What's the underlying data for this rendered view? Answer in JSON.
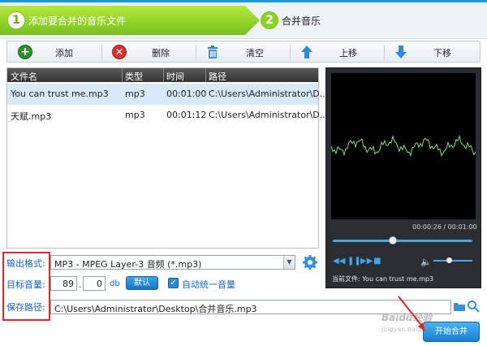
{
  "steps": [
    {
      "num": "1",
      "label": "添加要合并的音乐文件",
      "active": true
    },
    {
      "num": "2",
      "label": "合并音乐",
      "active": false
    }
  ],
  "toolbar": {
    "add_label": "添加",
    "delete_label": "删除",
    "clear_label": "清空",
    "move_up_label": "上移",
    "move_down_label": "下移"
  },
  "file_list": {
    "columns": [
      "文件名",
      "类型",
      "时间",
      "路径"
    ],
    "rows": [
      {
        "name": "You can trust me.mp3",
        "type": "mp3",
        "time": "00:01:00",
        "path": "C:\\Users\\Administrator\\D...",
        "selected": true
      },
      {
        "name": "天赋.mp3",
        "type": "mp3",
        "time": "00:01:12",
        "path": "C:\\Users\\Administrator\\D...",
        "selected": false
      }
    ]
  },
  "player": {
    "time": "00:00:26 / 00:01:00",
    "progress": 0.43,
    "volume": 0.4,
    "current_file": "当前文件: You can trust me.mp3",
    "wave_color": "#7fe07f"
  },
  "settings": {
    "format_label": "输出格式:",
    "format_value": "MP3 - MPEG Layer-3 音频 (*.mp3)",
    "volume_label": "目标音量:",
    "volume_int": "89",
    "volume_frac": "0",
    "volume_unit": "db",
    "default_btn": "默认",
    "auto_volume_label": "自动统一音量",
    "auto_volume_checked": true,
    "save_label": "保存路径:",
    "save_path": "C:\\Users\\Administrator\\Desktop\\合并音乐.mp3"
  },
  "start_button": "开始合并",
  "watermark": {
    "text": "Baidu经验",
    "url": "jingyan.baidu.com"
  },
  "colors": {
    "accent_blue": "#1a74c0",
    "step_green": "#79c020",
    "highlight_red": "#d9282f"
  }
}
